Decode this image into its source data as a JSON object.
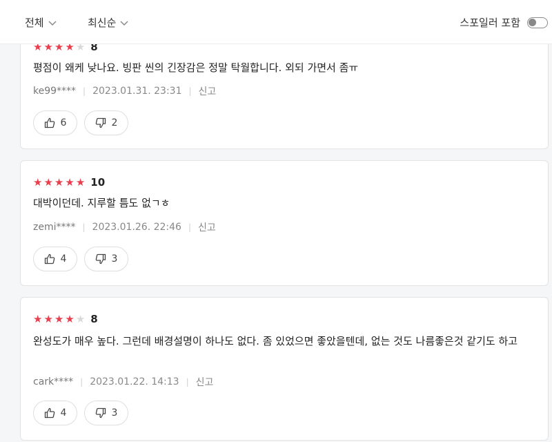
{
  "filters": {
    "all_label": "전체",
    "sort_label": "최신순",
    "spoiler_label": "스포일러 포함",
    "spoiler_on": false
  },
  "reviews": [
    {
      "stars": 4,
      "score": "8",
      "text": "평점이 왜케 낮나요. 빙판 씬의 긴장감은 정말 탁월합니다. 외되 가면서 좀ㅠ",
      "user": "ke99****",
      "date": "2023.01.31. 23:31",
      "report": "신고",
      "likes": "6",
      "dislikes": "2"
    },
    {
      "stars": 5,
      "score": "10",
      "text": "대박이던데. 지루할 틈도 없ㄱㅎ",
      "user": "zemi****",
      "date": "2023.01.26. 22:46",
      "report": "신고",
      "likes": "4",
      "dislikes": "3"
    },
    {
      "stars": 4,
      "score": "8",
      "text": "완성도가 매우 높다. 그런데 배경설명이 하나도 없다. 좀 있었으면 좋았을텐데, 없는 것도 나름좋은것 같기도 하고",
      "user": "cark****",
      "date": "2023.01.22. 14:13",
      "report": "신고",
      "likes": "4",
      "dislikes": "3"
    }
  ],
  "colors": {
    "star_on": "#e83e4e",
    "star_off": "#d9d9d9"
  },
  "icons": {
    "like": "thumbs-up-icon",
    "dislike": "thumbs-down-icon",
    "chevron": "chevron-down-icon"
  }
}
